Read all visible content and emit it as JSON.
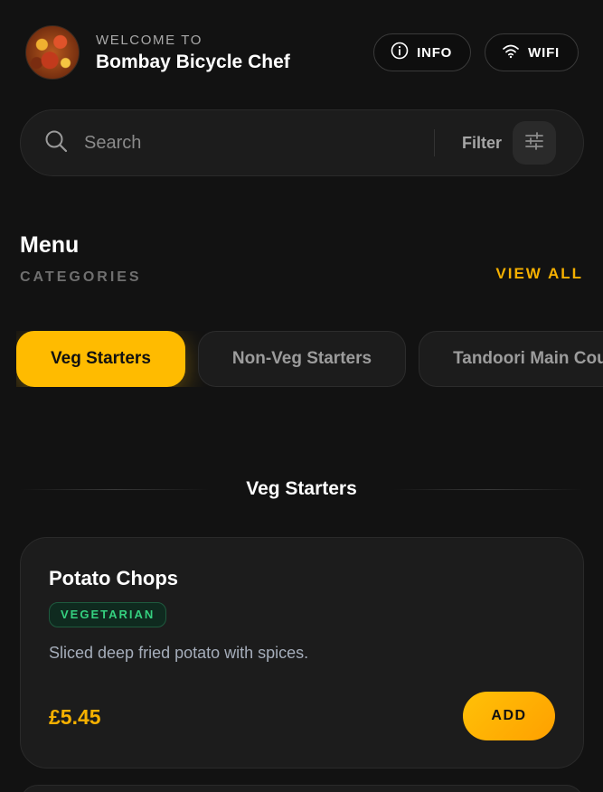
{
  "header": {
    "welcome": "WELCOME TO",
    "restaurant_name": "Bombay Bicycle Chef",
    "info_label": "INFO",
    "wifi_label": "WIFI"
  },
  "search": {
    "placeholder": "Search",
    "value": "",
    "filter_label": "Filter"
  },
  "menu": {
    "title": "Menu",
    "subtitle": "CATEGORIES",
    "view_all": "VIEW ALL"
  },
  "categories": [
    {
      "label": "Veg Starters",
      "active": true
    },
    {
      "label": "Non-Veg Starters",
      "active": false
    },
    {
      "label": "Tandoori Main Course",
      "active": false
    }
  ],
  "section": {
    "title": "Veg Starters"
  },
  "items": [
    {
      "name": "Potato Chops",
      "badge": "VEGETARIAN",
      "description": "Sliced deep fried potato with spices.",
      "price": "£5.45",
      "add_label": "ADD"
    }
  ],
  "icons": {
    "info": "info-icon",
    "wifi": "wifi-icon",
    "search": "search-icon",
    "filter": "sliders-icon"
  },
  "colors": {
    "background": "#121212",
    "accent": "#FFBB00",
    "vegetarian": "#35D07F",
    "card": "#1C1C1C"
  }
}
